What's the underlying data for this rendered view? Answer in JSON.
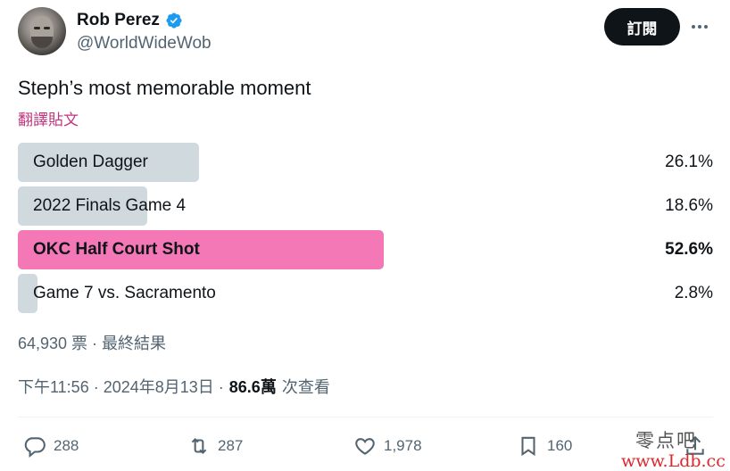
{
  "author": {
    "display_name": "Rob Perez",
    "handle": "@WorldWideWob",
    "verified": true
  },
  "follow_button_label": "訂閱",
  "tweet": {
    "text": "Steph’s most memorable moment",
    "translate_label": "翻譯貼文"
  },
  "poll": {
    "options": [
      {
        "label": "Golden Dagger",
        "percent": "26.1%",
        "value": 26.1,
        "winner": false
      },
      {
        "label": "2022 Finals Game 4",
        "percent": "18.6%",
        "value": 18.6,
        "winner": false
      },
      {
        "label": "OKC Half Court Shot",
        "percent": "52.6%",
        "value": 52.6,
        "winner": true
      },
      {
        "label": "Game 7 vs. Sacramento",
        "percent": "2.8%",
        "value": 2.8,
        "winner": false
      }
    ],
    "summary": "64,930 票 · 最終結果"
  },
  "meta": {
    "time_date": "下午11:56 · 2024年8月13日 ·",
    "views_count": "86.6萬",
    "views_label": "次查看"
  },
  "actions": {
    "replies": "288",
    "reposts": "287",
    "likes": "1,978",
    "bookmarks": "160"
  },
  "watermark": {
    "chinese": "零点吧",
    "url": "www.Ldb.cc"
  },
  "colors": {
    "winner_bar": "#f478b5",
    "other_bar": "#cfd9de",
    "translate_link": "#c0357e",
    "verified": "#1d9bf0"
  },
  "icons": [
    "verified-badge-icon",
    "more-icon",
    "reply-icon",
    "retweet-icon",
    "like-icon",
    "bookmark-icon",
    "share-icon"
  ]
}
